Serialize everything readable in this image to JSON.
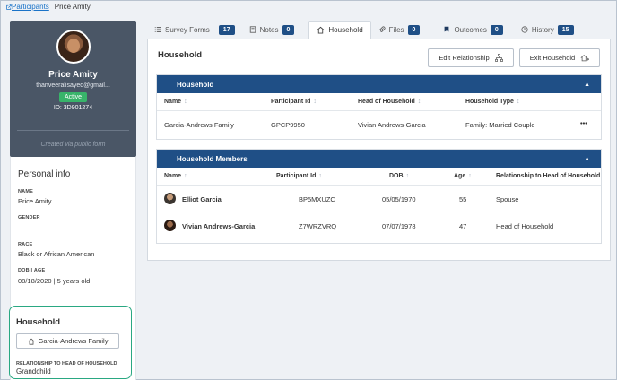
{
  "breadcrumb": {
    "parent": "Participants",
    "current": "Price Amity"
  },
  "profile": {
    "name": "Price Amity",
    "email": "thanveeralisayed@gmail...",
    "status": "Active",
    "id": "ID: 3D901274",
    "created": "Created via public form"
  },
  "personal": {
    "title": "Personal info",
    "name_label": "NAME",
    "name": "Price Amity",
    "gender_label": "GENDER",
    "gender": "",
    "race_label": "RACE",
    "race": "Black or African American",
    "dob_label": "DOB | AGE",
    "dob": "08/18/2020 | 5 years old"
  },
  "household_box": {
    "title": "Household",
    "button": "Garcia-Andrews Family",
    "rel_label": "RELATIONSHIP TO HEAD OF HOUSEHOLD",
    "rel_value": "Grandchild"
  },
  "tabs": [
    {
      "label": "Survey Forms",
      "count": "17",
      "icon": "list-icon"
    },
    {
      "label": "Notes",
      "count": "0",
      "icon": "notes-icon"
    },
    {
      "label": "Household",
      "count": "",
      "icon": "home-icon"
    },
    {
      "label": "Files",
      "count": "0",
      "icon": "paperclip-icon"
    },
    {
      "label": "Outcomes",
      "count": "0",
      "icon": "flag-icon"
    },
    {
      "label": "History",
      "count": "15",
      "icon": "clock-icon"
    }
  ],
  "main": {
    "title": "Household",
    "edit_btn": "Edit Relationship",
    "exit_btn": "Exit Household"
  },
  "household_table": {
    "title": "Household",
    "columns": [
      "Name",
      "Participant Id",
      "Head of Household",
      "Household Type"
    ],
    "row": {
      "name": "Garcia-Andrews Family",
      "pid": "GPCP9950",
      "head": "Vivian Andrews-Garcia",
      "type": "Family: Married Couple",
      "menu": "•••"
    }
  },
  "members_table": {
    "title": "Household Members",
    "columns": [
      "Name",
      "Participant Id",
      "DOB",
      "Age",
      "Relationship to Head of Household"
    ],
    "rows": [
      {
        "name": "Elliot Garcia",
        "pid": "BP5MXUZC",
        "dob": "05/05/1970",
        "age": "55",
        "rel": "Spouse"
      },
      {
        "name": "Vivian Andrews-Garcia",
        "pid": "Z7WRZVRQ",
        "dob": "07/07/1978",
        "age": "47",
        "rel": "Head of Household"
      }
    ]
  },
  "colors": {
    "primary": "#1f4f86",
    "active": "#38b46a",
    "highlight": "#2aa882"
  }
}
